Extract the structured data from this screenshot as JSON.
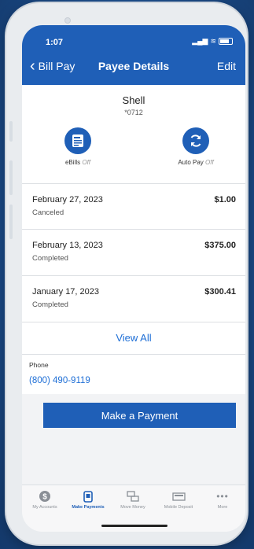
{
  "status_bar": {
    "time": "1:07",
    "signal": "▂▄▆",
    "wifi": "≋"
  },
  "nav": {
    "back_label": "Bill Pay",
    "title": "Payee Details",
    "edit_label": "Edit"
  },
  "payee": {
    "name": "Shell",
    "account": "*0712",
    "ebills": {
      "label": "eBills",
      "status": "Off",
      "icon": "ebill-document-icon"
    },
    "autopay": {
      "label": "Auto Pay",
      "status": "Off",
      "icon": "refresh-icon"
    }
  },
  "payments": [
    {
      "date": "February 27, 2023",
      "status": "Canceled",
      "amount": "$1.00"
    },
    {
      "date": "February 13, 2023",
      "status": "Completed",
      "amount": "$375.00"
    },
    {
      "date": "January 17, 2023",
      "status": "Completed",
      "amount": "$300.41"
    }
  ],
  "view_all_label": "View All",
  "contact": {
    "label": "Phone",
    "number": "(800) 490-9119"
  },
  "pay_button_label": "Make a Payment",
  "tabs": [
    {
      "label": "My Accounts",
      "icon": "dollar-icon",
      "active": false
    },
    {
      "label": "Make Payments",
      "icon": "phone-payment-icon",
      "active": true
    },
    {
      "label": "Move Money",
      "icon": "transfer-icon",
      "active": false
    },
    {
      "label": "Mobile Deposit",
      "icon": "check-deposit-icon",
      "active": false
    },
    {
      "label": "More",
      "icon": "more-dots-icon",
      "active": false
    }
  ],
  "colors": {
    "brand": "#1f5fb7",
    "link": "#1f6fd6",
    "background": "#1d4f8f"
  }
}
